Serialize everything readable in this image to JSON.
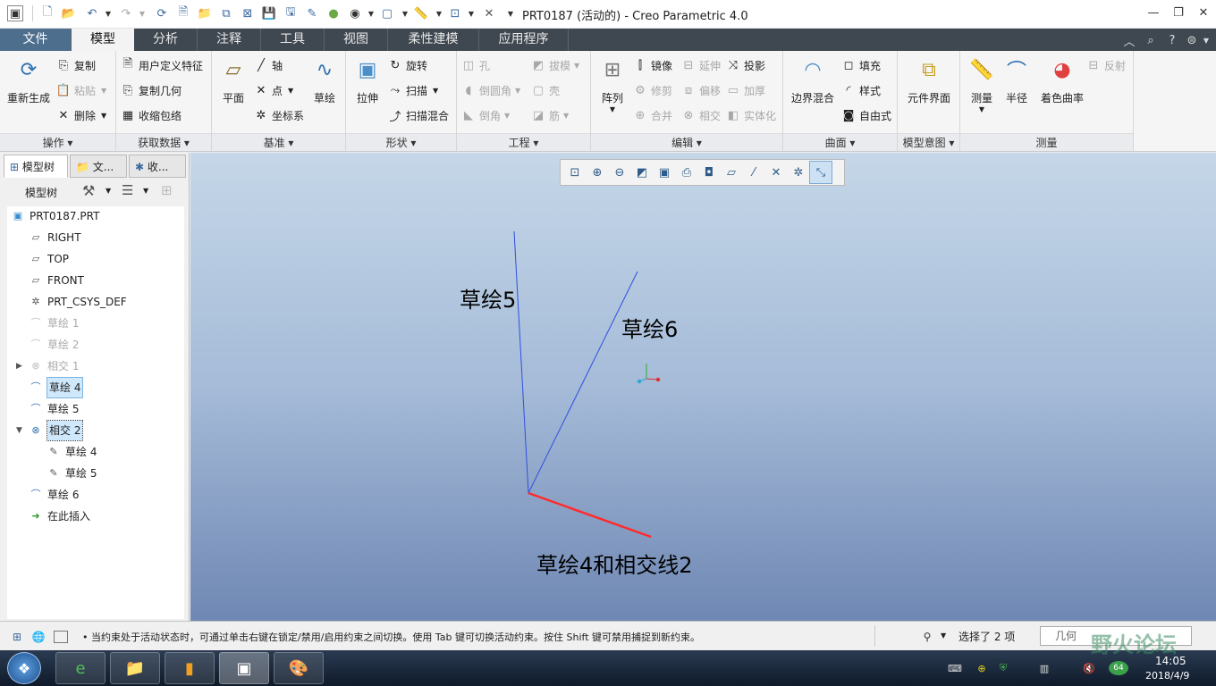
{
  "window": {
    "title": "PRT0187 (活动的) - Creo Parametric 4.0",
    "controls": [
      "minimize-icon",
      "restore-icon",
      "close-icon"
    ]
  },
  "quick_access": [
    "new-icon",
    "open-icon",
    "undo-icon",
    "redo-icon",
    "regenerate-icon",
    "save-icon",
    "windows-icon",
    "close-window-icon"
  ],
  "ribbon_tabs": [
    {
      "label": "文件",
      "state": "file"
    },
    {
      "label": "模型",
      "state": "active"
    },
    {
      "label": "分析",
      "state": ""
    },
    {
      "label": "注释",
      "state": ""
    },
    {
      "label": "工具",
      "state": ""
    },
    {
      "label": "视图",
      "state": ""
    },
    {
      "label": "柔性建模",
      "state": ""
    },
    {
      "label": "应用程序",
      "state": ""
    }
  ],
  "ribbon": {
    "operations": {
      "label": "操作",
      "regen": "重新生成",
      "copy": "复制",
      "paste": "粘贴",
      "delete": "删除"
    },
    "get_data": {
      "label": "获取数据",
      "udf": "用户定义特征",
      "copy_geom": "复制几何",
      "shrinkwrap": "收缩包络"
    },
    "datum": {
      "label": "基准",
      "plane": "平面",
      "axis": "轴",
      "point": "点",
      "csys": "坐标系",
      "sketch": "草绘"
    },
    "shapes": {
      "label": "形状",
      "extrude": "拉伸",
      "revolve": "旋转",
      "sweep": "扫描",
      "swept_blend": "扫描混合"
    },
    "engineering": {
      "label": "工程",
      "hole": "孔",
      "round": "倒圆角",
      "chamfer": "倒角",
      "draft": "拔模",
      "shell": "壳",
      "rib": "筋"
    },
    "editing": {
      "label": "编辑",
      "pattern": "阵列",
      "mirror": "镜像",
      "extend": "延伸",
      "project": "投影",
      "trim": "修剪",
      "offset": "偏移",
      "thicken": "加厚",
      "merge": "合并",
      "intersect": "相交",
      "solidify": "实体化"
    },
    "surfaces": {
      "label": "曲面",
      "boundary_blend": "边界混合",
      "fill": "填充",
      "style": "样式",
      "freestyle": "自由式"
    },
    "model_intent": {
      "label": "模型意图",
      "component_interface": "元件界面"
    },
    "measure": {
      "label": "测量",
      "measure": "测量",
      "radius": "半径",
      "shaded_curvature": "着色曲率",
      "reflection": "反射"
    }
  },
  "panel_tabs": [
    {
      "label": "模型树",
      "icon": "model-tree-icon"
    },
    {
      "label": "文...",
      "icon": "folder-icon"
    },
    {
      "label": "收...",
      "icon": "favorites-icon"
    }
  ],
  "tree_header": {
    "label": "模型树"
  },
  "tree": [
    {
      "label": "PRT0187.PRT",
      "icon": "part-icon",
      "state": ""
    },
    {
      "label": "RIGHT",
      "icon": "datum-plane-icon",
      "state": ""
    },
    {
      "label": "TOP",
      "icon": "datum-plane-icon",
      "state": ""
    },
    {
      "label": "FRONT",
      "icon": "datum-plane-icon",
      "state": ""
    },
    {
      "label": "PRT_CSYS_DEF",
      "icon": "csys-icon",
      "state": ""
    },
    {
      "label": "草绘 1",
      "icon": "sketch-icon",
      "state": "suppressed"
    },
    {
      "label": "草绘 2",
      "icon": "sketch-icon",
      "state": "suppressed"
    },
    {
      "label": "相交 1",
      "icon": "intersect-icon",
      "state": "suppressed"
    },
    {
      "label": "草绘 4",
      "icon": "sketch-icon",
      "state": "selected"
    },
    {
      "label": "草绘 5",
      "icon": "sketch-icon",
      "state": ""
    },
    {
      "label": "相交 2",
      "icon": "intersect-icon",
      "state": "focused"
    },
    {
      "label": "草绘 4",
      "icon": "sketch-child-icon",
      "state": "child"
    },
    {
      "label": "草绘 5",
      "icon": "sketch-child-icon",
      "state": "child"
    },
    {
      "label": "草绘 6",
      "icon": "sketch-icon",
      "state": ""
    },
    {
      "label": "在此插入",
      "icon": "insert-here-icon",
      "state": ""
    }
  ],
  "view_toolbar": [
    "refit-icon",
    "zoom-in-icon",
    "zoom-out-icon",
    "repaint-icon",
    "display-style-icon",
    "saved-orientations-icon",
    "view-manager-icon",
    "datum-planes-display-icon",
    "datum-axes-display-icon",
    "datum-points-display-icon",
    "csys-display-icon",
    "annotation-display-icon"
  ],
  "viewport": {
    "labels": {
      "sketch5": "草绘5",
      "sketch6": "草绘6",
      "intersect": "草绘4和相交线2"
    }
  },
  "status": {
    "message": "• 当约束处于活动状态时，可通过单击右键在锁定/禁用/启用约束之间切换。使用 Tab 键可切换活动约束。按住 Shift 键可禁用捕捉到新约束。",
    "selection": "选择了 2 项",
    "filter": "几何"
  },
  "taskbar": {
    "apps": [
      "ie-icon",
      "explorer-icon",
      "library-icon",
      "creo-icon",
      "paint-icon"
    ],
    "time": "14:05",
    "date": "2018/4/9",
    "badge": "64"
  },
  "watermark": "野火论坛",
  "colors": {
    "accent": "#4e6e8e",
    "sketch_line": "#2f4fe0",
    "intersect_line": "#ff2b2b"
  }
}
